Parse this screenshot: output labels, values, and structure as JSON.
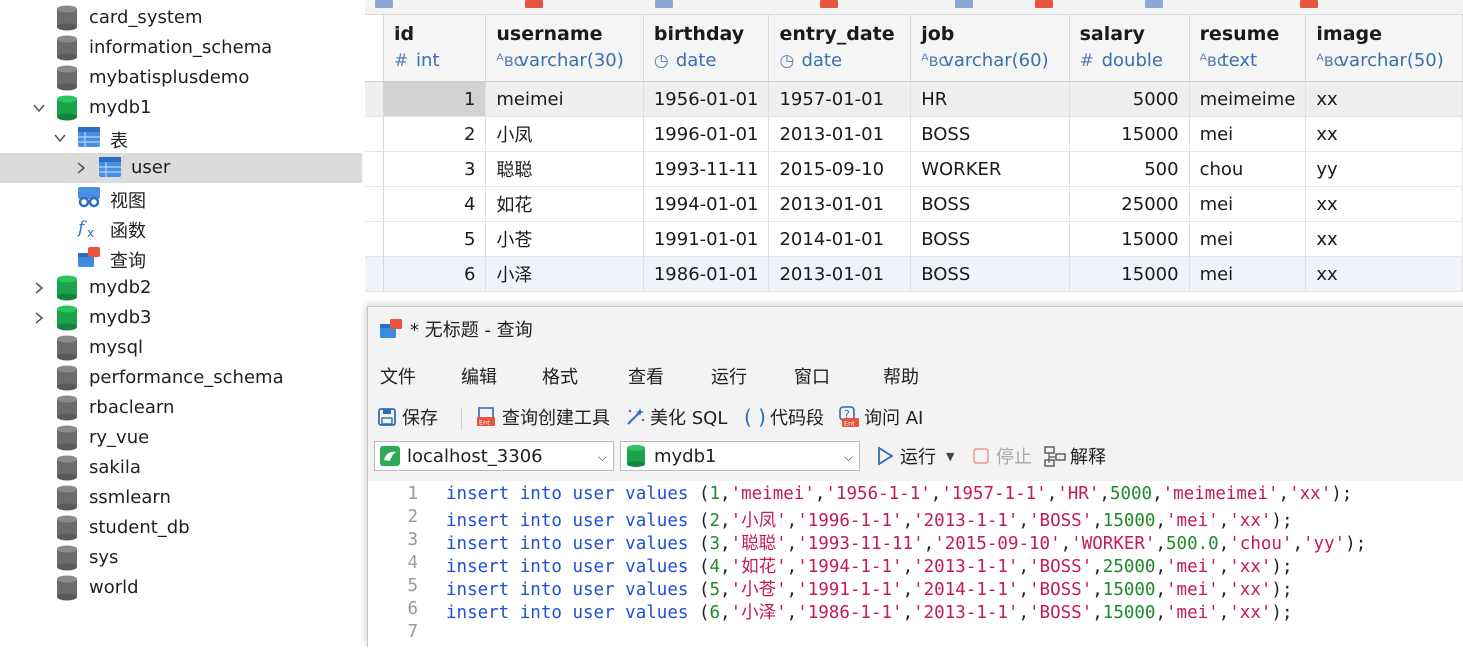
{
  "tree": {
    "items": [
      {
        "label": "card_system"
      },
      {
        "label": "information_schema"
      },
      {
        "label": "mybatisplusdemo"
      },
      {
        "label": "mydb1"
      },
      {
        "label": "表"
      },
      {
        "label": "user"
      },
      {
        "label": "视图"
      },
      {
        "label": "函数"
      },
      {
        "label": "查询"
      },
      {
        "label": "mydb2"
      },
      {
        "label": "mydb3"
      },
      {
        "label": "mysql"
      },
      {
        "label": "performance_schema"
      },
      {
        "label": "rbaclearn"
      },
      {
        "label": "ry_vue"
      },
      {
        "label": "sakila"
      },
      {
        "label": "ssmlearn"
      },
      {
        "label": "student_db"
      },
      {
        "label": "sys"
      },
      {
        "label": "world"
      }
    ]
  },
  "grid": {
    "columns": [
      {
        "name": "id",
        "type": "int",
        "type_icon": "#"
      },
      {
        "name": "username",
        "type": "varchar(30)",
        "type_icon": "ᴬʙc"
      },
      {
        "name": "birthday",
        "type": "date",
        "type_icon": "◷"
      },
      {
        "name": "entry_date",
        "type": "date",
        "type_icon": "◷"
      },
      {
        "name": "job",
        "type": "varchar(60)",
        "type_icon": "ᴬʙc"
      },
      {
        "name": "salary",
        "type": "double",
        "type_icon": "#"
      },
      {
        "name": "resume",
        "type": "text",
        "type_icon": "ᴬʙc"
      },
      {
        "name": "image",
        "type": "varchar(50)",
        "type_icon": "ᴬʙc"
      }
    ],
    "rows": [
      [
        "1",
        "meimei",
        "1956-01-01",
        "1957-01-01",
        "HR",
        "5000",
        "meimeime",
        "xx"
      ],
      [
        "2",
        "小凤",
        "1996-01-01",
        "2013-01-01",
        "BOSS",
        "15000",
        "mei",
        "xx"
      ],
      [
        "3",
        "聪聪",
        "1993-11-11",
        "2015-09-10",
        "WORKER",
        "500",
        "chou",
        "yy"
      ],
      [
        "4",
        "如花",
        "1994-01-01",
        "2013-01-01",
        "BOSS",
        "25000",
        "mei",
        "xx"
      ],
      [
        "5",
        "小苍",
        "1991-01-01",
        "2014-01-01",
        "BOSS",
        "15000",
        "mei",
        "xx"
      ],
      [
        "6",
        "小泽",
        "1986-01-01",
        "2013-01-01",
        "BOSS",
        "15000",
        "mei",
        "xx"
      ]
    ]
  },
  "query_window": {
    "title": "* 无标题 - 查询",
    "menu": [
      "文件",
      "编辑",
      "格式",
      "查看",
      "运行",
      "窗口",
      "帮助"
    ],
    "toolbar": {
      "save": "保存",
      "query_builder": "查询创建工具",
      "beautify": "美化 SQL",
      "snippet": "代码段",
      "ask_ai": "询问 AI"
    },
    "connection": "localhost_3306",
    "database": "mydb1",
    "run": "运行",
    "stop": "停止",
    "explain": "解释",
    "line_numbers": [
      "1",
      "2",
      "3",
      "4",
      "5",
      "6",
      "7"
    ],
    "sql_lines": [
      {
        "values": [
          "1",
          "'meimei'",
          "'1956-1-1'",
          "'1957-1-1'",
          "'HR'",
          "5000",
          "'meimeimei'",
          "'xx'"
        ]
      },
      {
        "values": [
          "2",
          "'小凤'",
          "'1996-1-1'",
          "'2013-1-1'",
          "'BOSS'",
          "15000",
          "'mei'",
          "'xx'"
        ]
      },
      {
        "values": [
          "3",
          "'聪聪'",
          "'1993-11-11'",
          "'2015-09-10'",
          "'WORKER'",
          "500.0",
          "'chou'",
          "'yy'"
        ]
      },
      {
        "values": [
          "4",
          "'如花'",
          "'1994-1-1'",
          "'2013-1-1'",
          "'BOSS'",
          "25000",
          "'mei'",
          "'xx'"
        ]
      },
      {
        "values": [
          "5",
          "'小苍'",
          "'1991-1-1'",
          "'2014-1-1'",
          "'BOSS'",
          "15000",
          "'mei'",
          "'xx'"
        ]
      },
      {
        "values": [
          "6",
          "'小泽'",
          "'1986-1-1'",
          "'2013-1-1'",
          "'BOSS'",
          "15000",
          "'mei'",
          "'xx'"
        ]
      }
    ],
    "keywords": [
      "insert",
      "into",
      "user",
      "values"
    ]
  },
  "colors": {
    "db_icon": "#6b6b6b",
    "db_open_icon": "#1aa34a",
    "keyword": "#1f4fd6",
    "string": "#c41a5a",
    "number": "#1f8a2a"
  }
}
